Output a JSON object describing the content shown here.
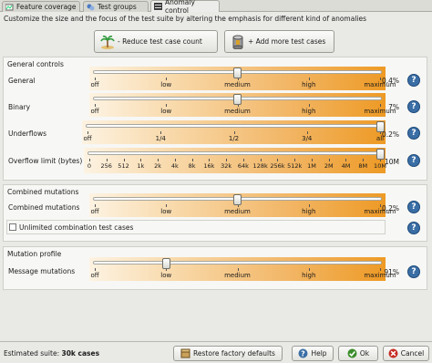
{
  "tabs": [
    {
      "label": "Feature coverage",
      "icon": "feature-coverage-icon",
      "active": false
    },
    {
      "label": "Test groups",
      "icon": "test-groups-icon",
      "active": false
    },
    {
      "label": "Anomaly control",
      "icon": "anomaly-control-icon",
      "active": true
    }
  ],
  "description": "Customize the size and the focus of the test suite by altering the emphasis for different kind of anomalies",
  "buttons": {
    "reduce": {
      "label": "- Reduce test case count",
      "icon": "palm-tree-island-icon"
    },
    "add": {
      "label": "+ Add more test cases",
      "icon": "cylinder-stack-icon"
    }
  },
  "general": {
    "title": "General controls",
    "general": {
      "label": "General",
      "value": "0.4%",
      "level": 0.5,
      "ticks": [
        "off",
        "low",
        "medium",
        "high",
        "maximum"
      ]
    },
    "binary": {
      "label": "Binary",
      "value": "7%",
      "level": 0.5,
      "ticks": [
        "off",
        "low",
        "medium",
        "high",
        "maximum"
      ]
    },
    "underflows": {
      "label": "Underflows",
      "value": "0.2%",
      "level": 1.0,
      "ticks": [
        "off",
        "1/4",
        "1/2",
        "3/4",
        "all"
      ]
    },
    "overflow": {
      "label": "Overflow limit (bytes)",
      "value": "10M",
      "level": 1.0,
      "ticks": [
        "0",
        "256",
        "512",
        "1k",
        "2k",
        "4k",
        "8k",
        "16k",
        "32k",
        "64k",
        "128k",
        "256k",
        "512k",
        "1M",
        "2M",
        "4M",
        "8M",
        "10M"
      ]
    }
  },
  "combined": {
    "title": "Combined mutations",
    "combined": {
      "label": "Combined mutations",
      "value": "0.2%",
      "level": 0.5,
      "ticks": [
        "off",
        "low",
        "medium",
        "high",
        "maximum"
      ]
    },
    "unlimited": {
      "label": "Unlimited combination test cases",
      "checked": false
    }
  },
  "mutation": {
    "title": "Mutation profile",
    "message": {
      "label": "Message mutations",
      "value": "91%",
      "level": 0.25,
      "ticks": [
        "off",
        "low",
        "medium",
        "high",
        "maximum"
      ]
    }
  },
  "footer": {
    "estimate_label": "Estimated suite:",
    "estimate_value": "30k cases",
    "restore": "Restore factory defaults",
    "help": "Help",
    "ok": "Ok",
    "cancel": "Cancel"
  },
  "colors": {
    "accent": "#ee9a25",
    "help_blue": "#3a6ea5"
  }
}
